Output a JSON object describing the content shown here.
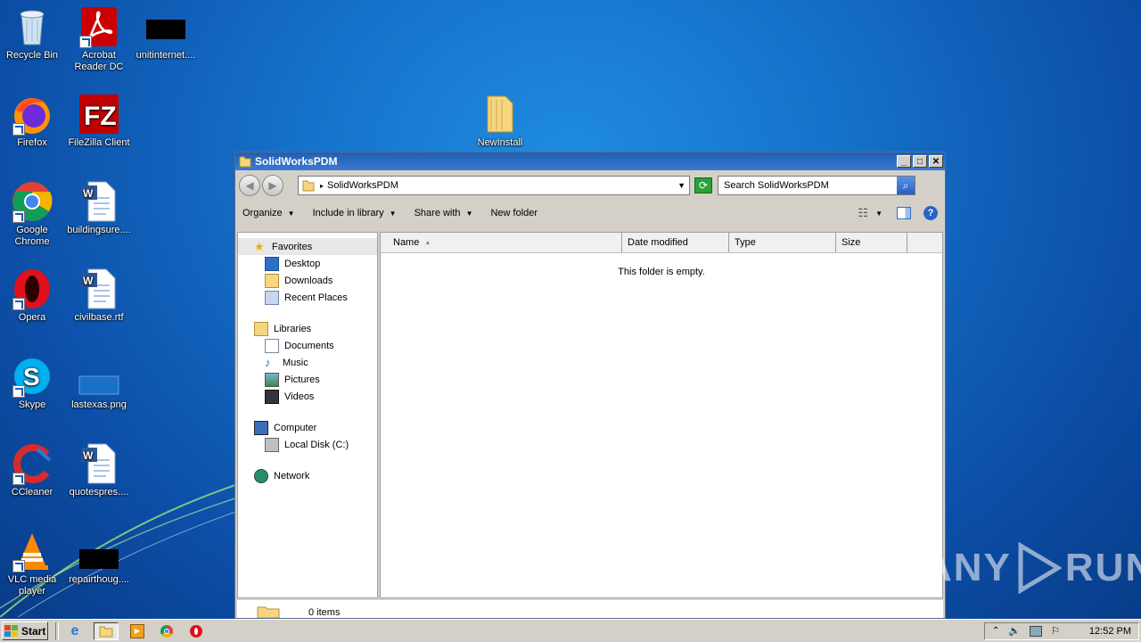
{
  "desktop": {
    "icons": [
      {
        "label": "Recycle Bin",
        "icon": "recycle-bin-icon"
      },
      {
        "label": "Acrobat Reader DC",
        "icon": "acrobat-icon"
      },
      {
        "label": "unitinternet....",
        "icon": "black-thumbnail-icon"
      },
      {
        "label": "Firefox",
        "icon": "firefox-icon"
      },
      {
        "label": "FileZilla Client",
        "icon": "filezilla-icon"
      },
      {
        "label": "NewInstall",
        "icon": "folder-icon"
      },
      {
        "label": "Google Chrome",
        "icon": "chrome-icon"
      },
      {
        "label": "buildingsure....",
        "icon": "word-doc-icon"
      },
      {
        "label": "Opera",
        "icon": "opera-icon"
      },
      {
        "label": "civilbase.rtf",
        "icon": "word-doc-icon"
      },
      {
        "label": "Skype",
        "icon": "skype-icon"
      },
      {
        "label": "lastexas.png",
        "icon": "image-thumbnail-icon"
      },
      {
        "label": "CCleaner",
        "icon": "ccleaner-icon"
      },
      {
        "label": "quotespres....",
        "icon": "word-doc-icon"
      },
      {
        "label": "VLC media player",
        "icon": "vlc-icon"
      },
      {
        "label": "repairthoug....",
        "icon": "black-thumbnail-icon"
      }
    ]
  },
  "window": {
    "title": "SolidWorksPDM",
    "address": "SolidWorksPDM",
    "search_placeholder": "Search SolidWorksPDM",
    "toolbar": {
      "organize": "Organize",
      "include_in_library": "Include in library",
      "share_with": "Share with",
      "new_folder": "New folder"
    },
    "nav": {
      "favorites": "Favorites",
      "favorites_items": [
        "Desktop",
        "Downloads",
        "Recent Places"
      ],
      "libraries": "Libraries",
      "libraries_items": [
        "Documents",
        "Music",
        "Pictures",
        "Videos"
      ],
      "computer": "Computer",
      "computer_items": [
        "Local Disk (C:)"
      ],
      "network": "Network"
    },
    "columns": [
      "Name",
      "Date modified",
      "Type",
      "Size"
    ],
    "empty_message": "This folder is empty.",
    "status": "0 items"
  },
  "taskbar": {
    "start_label": "Start",
    "clock": "12:52 PM"
  },
  "watermark": {
    "left": "ANY",
    "right": "RUN"
  }
}
